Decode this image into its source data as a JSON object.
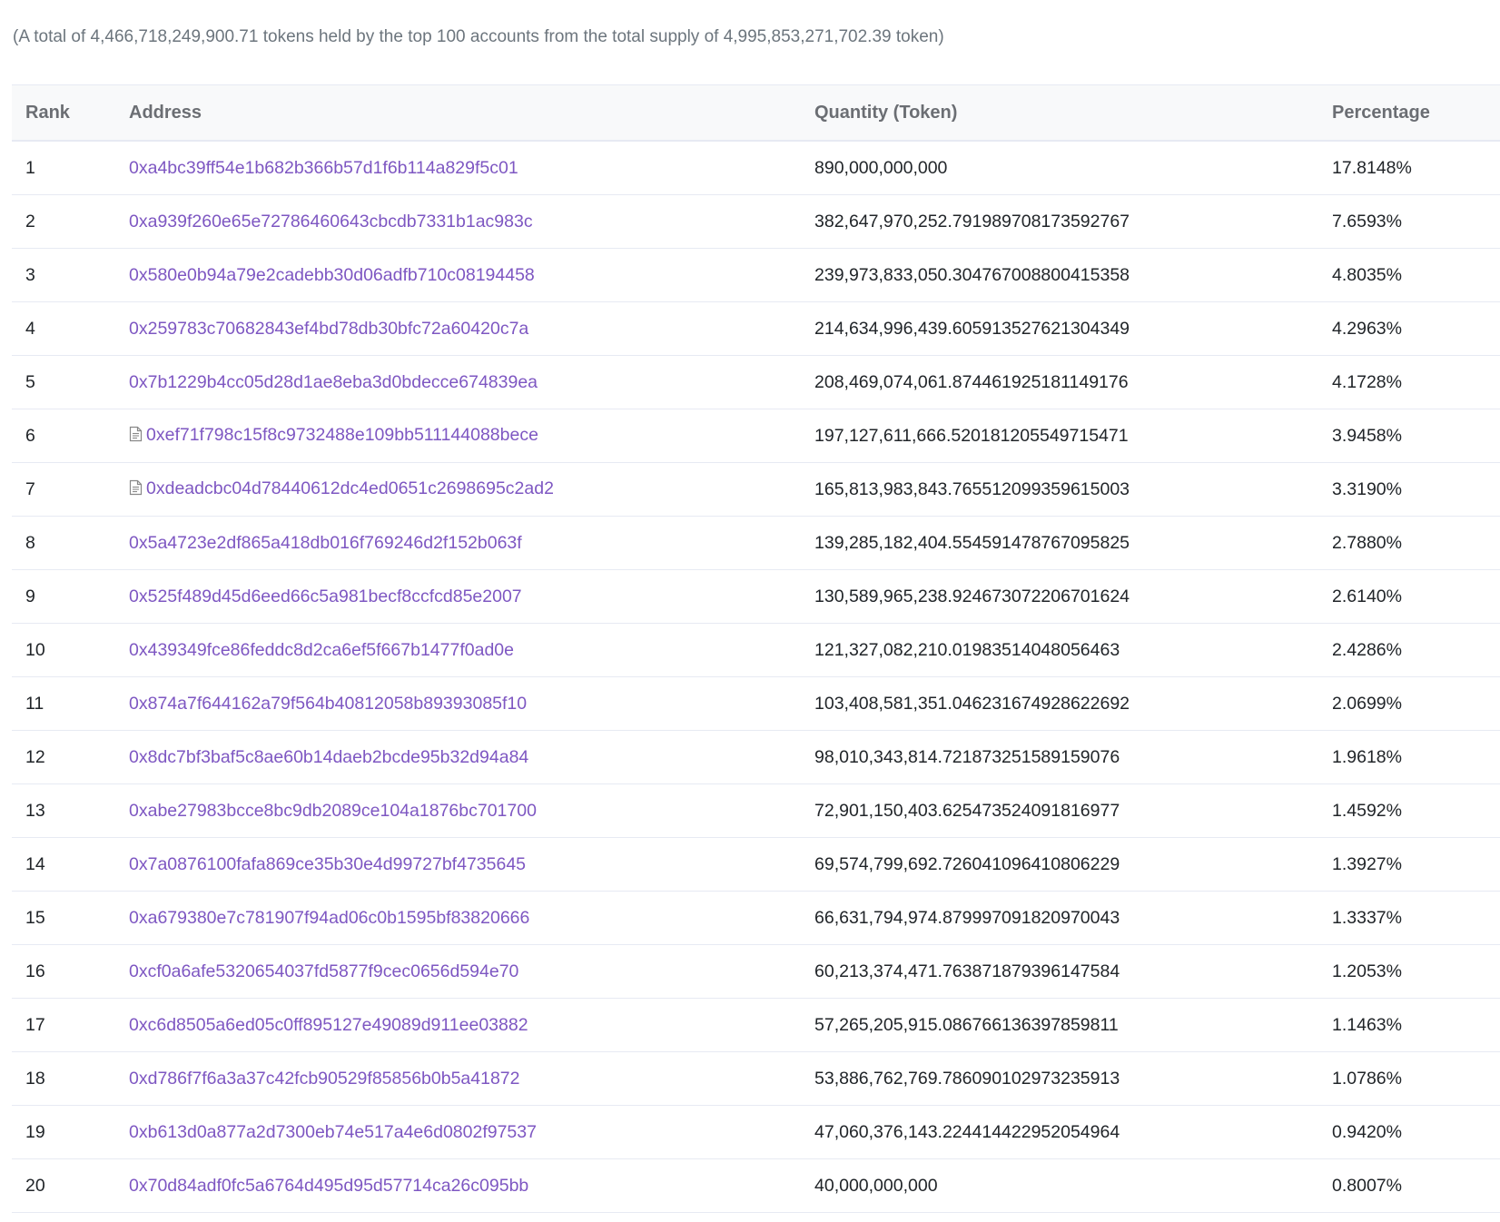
{
  "summary": "(A total of 4,466,718,249,900.71 tokens held by the top 100 accounts from the total supply of 4,995,853,271,702.39 token)",
  "colors": {
    "link": "#7e57c2",
    "header_bg": "#f8f9fa",
    "border": "#e7eaf3"
  },
  "table": {
    "headers": {
      "rank": "Rank",
      "address": "Address",
      "quantity": "Quantity (Token)",
      "percentage": "Percentage"
    },
    "rows": [
      {
        "rank": "1",
        "address": "0xa4bc39ff54e1b682b366b57d1f6b114a829f5c01",
        "quantity": "890,000,000,000",
        "percentage": "17.8148%",
        "contract": false
      },
      {
        "rank": "2",
        "address": "0xa939f260e65e72786460643cbcdb7331b1ac983c",
        "quantity": "382,647,970,252.791989708173592767",
        "percentage": "7.6593%",
        "contract": false
      },
      {
        "rank": "3",
        "address": "0x580e0b94a79e2cadebb30d06adfb710c08194458",
        "quantity": "239,973,833,050.304767008800415358",
        "percentage": "4.8035%",
        "contract": false
      },
      {
        "rank": "4",
        "address": "0x259783c70682843ef4bd78db30bfc72a60420c7a",
        "quantity": "214,634,996,439.605913527621304349",
        "percentage": "4.2963%",
        "contract": false
      },
      {
        "rank": "5",
        "address": "0x7b1229b4cc05d28d1ae8eba3d0bdecce674839ea",
        "quantity": "208,469,074,061.874461925181149176",
        "percentage": "4.1728%",
        "contract": false
      },
      {
        "rank": "6",
        "address": "0xef71f798c15f8c9732488e109bb511144088bece",
        "quantity": "197,127,611,666.520181205549715471",
        "percentage": "3.9458%",
        "contract": true
      },
      {
        "rank": "7",
        "address": "0xdeadcbc04d78440612dc4ed0651c2698695c2ad2",
        "quantity": "165,813,983,843.765512099359615003",
        "percentage": "3.3190%",
        "contract": true
      },
      {
        "rank": "8",
        "address": "0x5a4723e2df865a418db016f769246d2f152b063f",
        "quantity": "139,285,182,404.554591478767095825",
        "percentage": "2.7880%",
        "contract": false
      },
      {
        "rank": "9",
        "address": "0x525f489d45d6eed66c5a981becf8ccfcd85e2007",
        "quantity": "130,589,965,238.924673072206701624",
        "percentage": "2.6140%",
        "contract": false
      },
      {
        "rank": "10",
        "address": "0x439349fce86feddc8d2ca6ef5f667b1477f0ad0e",
        "quantity": "121,327,082,210.01983514048056463",
        "percentage": "2.4286%",
        "contract": false
      },
      {
        "rank": "11",
        "address": "0x874a7f644162a79f564b40812058b89393085f10",
        "quantity": "103,408,581,351.046231674928622692",
        "percentage": "2.0699%",
        "contract": false
      },
      {
        "rank": "12",
        "address": "0x8dc7bf3baf5c8ae60b14daeb2bcde95b32d94a84",
        "quantity": "98,010,343,814.721873251589159076",
        "percentage": "1.9618%",
        "contract": false
      },
      {
        "rank": "13",
        "address": "0xabe27983bcce8bc9db2089ce104a1876bc701700",
        "quantity": "72,901,150,403.625473524091816977",
        "percentage": "1.4592%",
        "contract": false
      },
      {
        "rank": "14",
        "address": "0x7a0876100fafa869ce35b30e4d99727bf4735645",
        "quantity": "69,574,799,692.726041096410806229",
        "percentage": "1.3927%",
        "contract": false
      },
      {
        "rank": "15",
        "address": "0xa679380e7c781907f94ad06c0b1595bf83820666",
        "quantity": "66,631,794,974.879997091820970043",
        "percentage": "1.3337%",
        "contract": false
      },
      {
        "rank": "16",
        "address": "0xcf0a6afe5320654037fd5877f9cec0656d594e70",
        "quantity": "60,213,374,471.763871879396147584",
        "percentage": "1.2053%",
        "contract": false
      },
      {
        "rank": "17",
        "address": "0xc6d8505a6ed05c0ff895127e49089d911ee03882",
        "quantity": "57,265,205,915.086766136397859811",
        "percentage": "1.1463%",
        "contract": false
      },
      {
        "rank": "18",
        "address": "0xd786f7f6a3a37c42fcb90529f85856b0b5a41872",
        "quantity": "53,886,762,769.786090102973235913",
        "percentage": "1.0786%",
        "contract": false
      },
      {
        "rank": "19",
        "address": "0xb613d0a877a2d7300eb74e517a4e6d0802f97537",
        "quantity": "47,060,376,143.224414422952054964",
        "percentage": "0.9420%",
        "contract": false
      },
      {
        "rank": "20",
        "address": "0x70d84adf0fc5a6764d495d95d57714ca26c095bb",
        "quantity": "40,000,000,000",
        "percentage": "0.8007%",
        "contract": false
      }
    ]
  }
}
